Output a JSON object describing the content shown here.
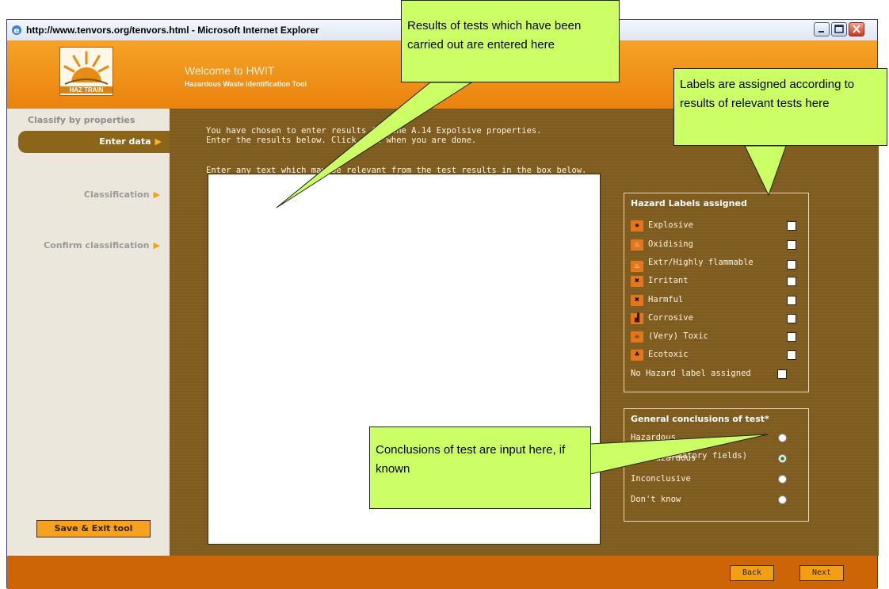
{
  "window": {
    "title": "http://www.tenvors.org/tenvors.html - Microsoft Internet Explorer"
  },
  "header": {
    "logo_text": "HAZ TRAIN",
    "welcome": "Welcome to HWIT",
    "subtitle": "Hazardous Waste Identification Tool"
  },
  "sidebar": {
    "heading": "Classify by properties",
    "items": [
      {
        "label": "Enter data",
        "active": true
      },
      {
        "label": "Classification",
        "active": false
      },
      {
        "label": "Confirm classification",
        "active": false
      }
    ],
    "save_exit_label": "Save & Exit tool"
  },
  "main": {
    "intro_line1": "You have chosen to enter results for the A.14 Expolsive properties.",
    "intro_line2": "Enter the results below. Click next when you are done.",
    "instruction": "Enter any text which may be relevant from the test results in the box below.",
    "results_value": ""
  },
  "hazard_labels": {
    "title": "Hazard Labels assigned",
    "items": [
      {
        "label": "Explosive",
        "icon": "explosive-icon",
        "checked": false
      },
      {
        "label": "Oxidising",
        "icon": "oxidising-icon",
        "checked": false
      },
      {
        "label": "Extr/Highly flammable",
        "icon": "flammable-icon",
        "checked": false
      },
      {
        "label": "Irritant",
        "icon": "irritant-icon",
        "checked": false
      },
      {
        "label": "Harmful",
        "icon": "harmful-icon",
        "checked": false
      },
      {
        "label": "Corrosive",
        "icon": "corrosive-icon",
        "checked": false
      },
      {
        "label": "(Very) Toxic",
        "icon": "toxic-icon",
        "checked": false
      },
      {
        "label": "Ecotoxic",
        "icon": "ecotoxic-icon",
        "checked": false
      },
      {
        "label": "No Hazard label assigned",
        "icon": "",
        "checked": false
      }
    ]
  },
  "conclusions": {
    "title": "General conclusions of test*",
    "options": [
      {
        "label": "Hazardous",
        "selected": false
      },
      {
        "label": "Non-Hazardous",
        "selected": true
      },
      {
        "label": "Inconclusive",
        "selected": false
      },
      {
        "label": "Don't know",
        "selected": false
      }
    ],
    "mandatory_note": "(* = mandatory fields)"
  },
  "footer": {
    "back_label": "Back",
    "next_label": "Next"
  },
  "callouts": {
    "results": "Results of tests which have been carried out are entered here",
    "labels": "Labels are assigned according to results of relevant tests here",
    "conclusions": "Conclusions of test are input here, if known"
  },
  "colors": {
    "brand_orange": "#f6a227",
    "panel_brown": "#7b5b1f",
    "callout_green": "#ccff66"
  }
}
